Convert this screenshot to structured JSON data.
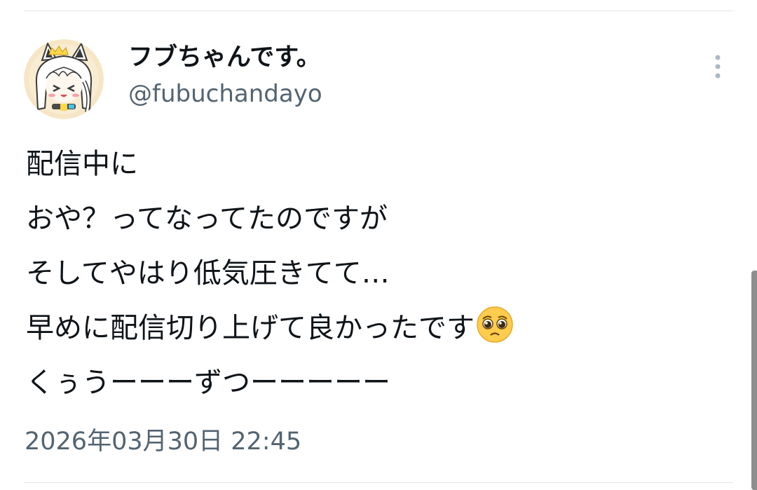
{
  "tweet": {
    "author": {
      "display_name": "フブちゃんです。",
      "handle": "@fubuchandayo",
      "avatar_icon": "fox-girl-avatar"
    },
    "more_icon": "more-vertical-icon",
    "lines": [
      "配信中に",
      "おや？ってなってたのですが",
      "そしてやはり低気圧きてて…",
      "早めに配信切り上げて良かったです",
      "くぅうーーーずつーーーーー"
    ],
    "emoji": "pleading-face-emoji",
    "timestamp": "2026年03月30日 22:45"
  },
  "colors": {
    "text_primary": "#0f1419",
    "text_secondary": "#536471",
    "divider": "#e1e5e8",
    "more_icon": "#aeb8c2",
    "scrollbar": "#8e8e8e"
  }
}
